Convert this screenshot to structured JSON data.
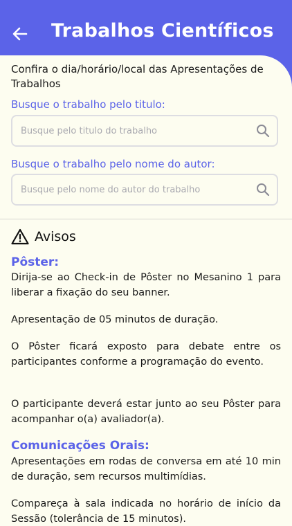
{
  "header": {
    "title": "Trabalhos Científicos",
    "back_icon": "arrow-left-icon"
  },
  "intro": "Confira o dia/horário/local das Apresentações de Trabalhos",
  "search_title": {
    "label": "Busque o trabalho pelo titulo:",
    "placeholder": "Busque pelo titulo do trabalho",
    "value": ""
  },
  "search_author": {
    "label": "Busque o trabalho pelo nome do autor:",
    "placeholder": "Busque pelo nome do autor do trabalho",
    "value": ""
  },
  "avisos": {
    "title": "Avisos",
    "icon": "warning-icon"
  },
  "poster": {
    "title": "Pôster:",
    "paragraphs": [
      "Dirija-se ao Check-in de Pôster no Mesanino 1 para liberar a fixação do seu banner.",
      "Apresentação de 05 minutos de duração.",
      "O Pôster ficará exposto para debate entre os participantes conforme a programação do evento.",
      "O participante deverá estar junto ao seu Pôster para acompanhar o(a) avaliador(a)."
    ]
  },
  "orais": {
    "title": "Comunicações Orais:",
    "paragraphs": [
      "Apresentações em rodas de conversa em até 10 min de duração, sem recursos multimídias.",
      "Compareça à sala indicada no horário de início da Sessão (tolerância de 15 minutos)."
    ]
  },
  "colors": {
    "primary": "#5b63e8",
    "background": "#fdfdf0",
    "text": "#1a1a1a"
  }
}
